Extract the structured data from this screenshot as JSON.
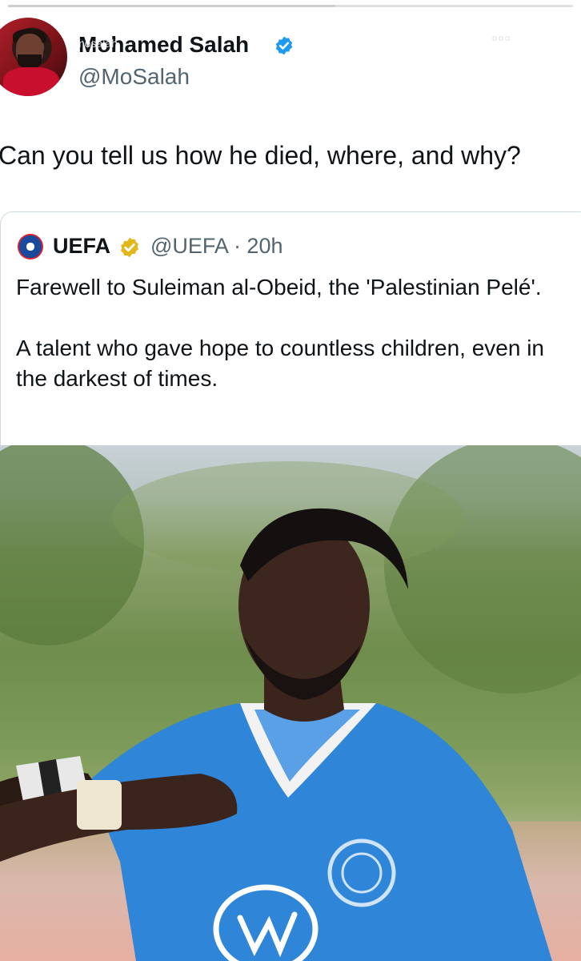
{
  "story": {
    "username": "mosalah",
    "progress_fraction": 0.58,
    "more_icon": "more-horizontal-icon",
    "close_icon": "close-icon"
  },
  "tweet": {
    "display_name": "Mohamed Salah",
    "handle": "@MoSalah",
    "verified": true,
    "verified_color": "#1d9bf0",
    "text": "Can you tell us how he died, where, and why?"
  },
  "quoted_tweet": {
    "display_name": "UEFA",
    "verified_org": true,
    "badge_color": "#e2b719",
    "handle_time": "@UEFA · 20h",
    "paragraphs": [
      "Farewell to Suleiman al-Obeid, the 'Palestinian Pelé'.",
      "A talent who gave hope to countless children, even in the darkest of times."
    ],
    "image": "football-player-photo"
  }
}
